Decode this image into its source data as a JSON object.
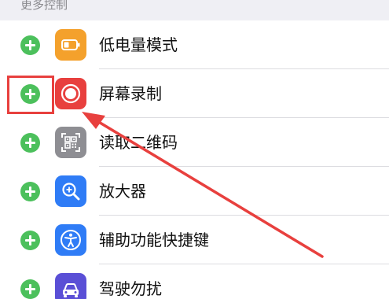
{
  "section": {
    "title": "更多控制"
  },
  "colors": {
    "add_button": "#4cc05c",
    "annotation": "#e8403e"
  },
  "items": [
    {
      "label": "低电量模式",
      "icon": "battery-icon",
      "icon_bg": "#f4a12c"
    },
    {
      "label": "屏幕录制",
      "icon": "screen-record-icon",
      "icon_bg": "#e8403e"
    },
    {
      "label": "读取二维码",
      "icon": "qr-code-icon",
      "icon_bg": "#8e8e93"
    },
    {
      "label": "放大器",
      "icon": "magnifier-icon",
      "icon_bg": "#2f7cf6"
    },
    {
      "label": "辅助功能快捷键",
      "icon": "accessibility-icon",
      "icon_bg": "#2f7cf6"
    },
    {
      "label": "驾驶勿扰",
      "icon": "car-icon",
      "icon_bg": "#5a4fd6"
    }
  ]
}
